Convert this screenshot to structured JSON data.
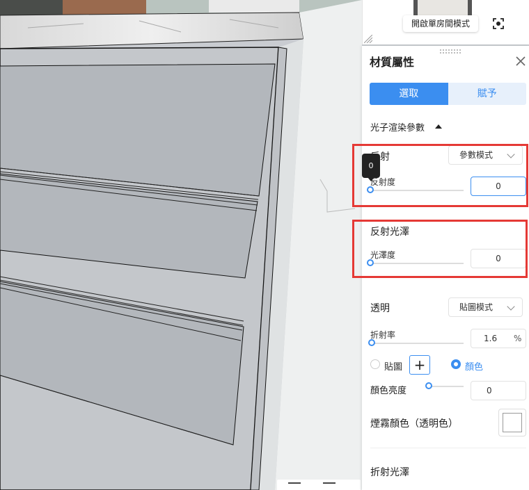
{
  "minimap": {
    "single_room_button": "開啟單房間模式",
    "focus_icon": "focus-icon"
  },
  "panel": {
    "title": "材質屬性",
    "close_icon": "close-icon",
    "tabs": [
      {
        "label": "選取",
        "active": true
      },
      {
        "label": "賦予",
        "active": false
      }
    ],
    "section": {
      "label": "光子渲染參數",
      "expanded": true
    },
    "reflection": {
      "label": "反射",
      "mode": "參數模式",
      "degree_label": "反射度",
      "degree_value": "0",
      "tooltip": "0"
    },
    "gloss": {
      "label": "反射光澤",
      "gloss_label": "光澤度",
      "gloss_value": "0"
    },
    "transparency": {
      "label": "透明",
      "mode": "貼圖模式",
      "refraction_label": "折射率",
      "refraction_value": "1.6",
      "refraction_unit": "%",
      "texture_option": "貼圖",
      "color_option": "顏色",
      "color_selected": true,
      "brightness_label": "顏色亮度",
      "brightness_value": "0",
      "fog_label": "煙霧顏色（透明色）"
    },
    "refraction_gloss": {
      "label": "折射光澤"
    }
  },
  "colors": {
    "accent": "#3b8ef0",
    "highlight_box": "#e53935"
  }
}
